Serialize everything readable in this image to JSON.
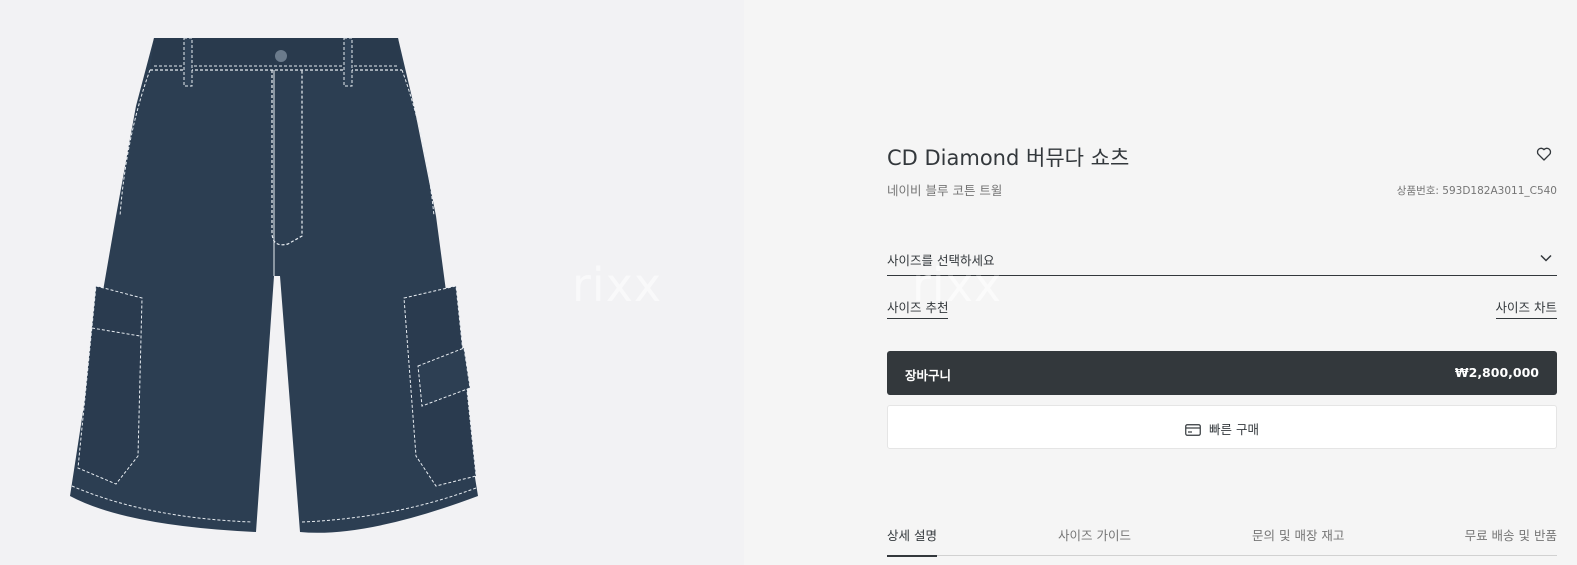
{
  "product": {
    "title": "CD Diamond 버뮤다 쇼츠",
    "subtitle": "네이비 블루 코튼 트윌",
    "reference": "상품번호: 593D182A3011_C540",
    "image_alt": "navy denim bermuda cargo shorts with white contrast stitching"
  },
  "size": {
    "select_label": "사이즈를 선택하세요",
    "recommend_link": "사이즈 추천",
    "chart_link": "사이즈 차트"
  },
  "actions": {
    "cart_label": "장바구니",
    "price": "₩2,800,000",
    "quick_buy_label": "빠른 구매"
  },
  "tabs": [
    {
      "label": "상세 설명",
      "active": true
    },
    {
      "label": "사이즈 가이드",
      "active": false
    },
    {
      "label": "문의 및 매장 재고",
      "active": false
    },
    {
      "label": "무료 배송 및 반품",
      "active": false
    }
  ],
  "watermark": "rixx",
  "colors": {
    "primary": "#33383c",
    "muted": "#757575",
    "gallery_bg": "#f2f2f4",
    "panel_bg": "#f5f5f5",
    "denim": "#2c3e52"
  },
  "icons": {
    "wishlist": "heart-icon",
    "dropdown": "chevron-down-icon",
    "quick_buy": "credit-card-icon"
  }
}
